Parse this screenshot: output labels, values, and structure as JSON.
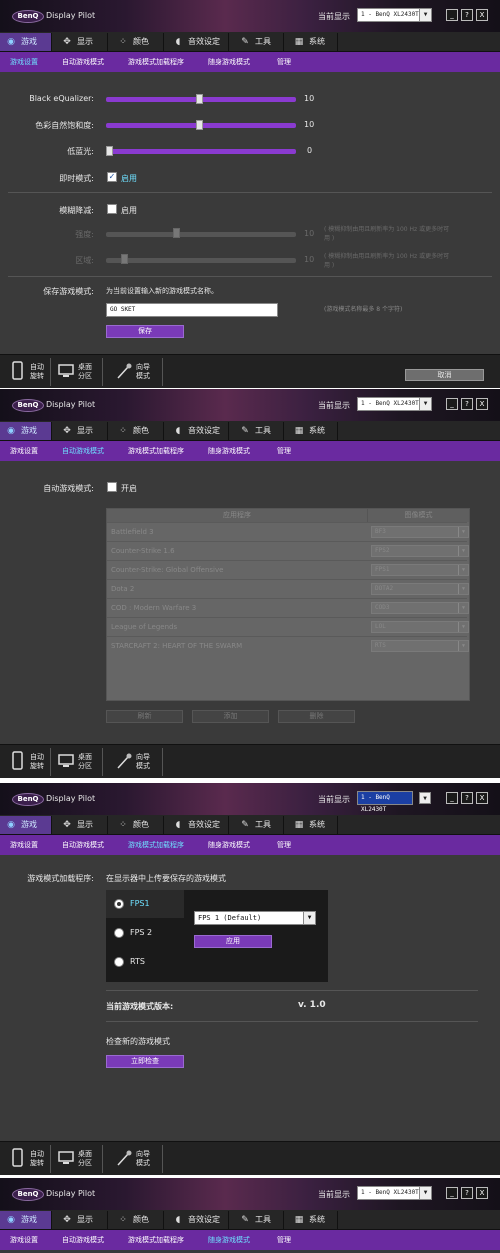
{
  "app": {
    "logo": "BenQ",
    "title": "Display Pilot",
    "monitor_label": "当前显示",
    "monitor_value": "1 - BenQ XL2430T",
    "minimize": "_",
    "help": "?",
    "close": "X"
  },
  "tabs": [
    {
      "label": "游戏",
      "icon": "gamepad-icon"
    },
    {
      "label": "显示",
      "icon": "display-move-icon"
    },
    {
      "label": "颜色",
      "icon": "palette-icon"
    },
    {
      "label": "音效设定",
      "icon": "speaker-icon"
    },
    {
      "label": "工具",
      "icon": "wrench-icon"
    },
    {
      "label": "系统",
      "icon": "system-icon"
    }
  ],
  "subtabs": [
    "游戏设置",
    "自动游戏模式",
    "游戏模式加载程序",
    "随身游戏模式",
    "管理"
  ],
  "footer": {
    "auto_rotate": "自动\n旋转",
    "desktop_partition": "桌面\n分区",
    "wizard": "向导\n模式",
    "cancel": "取消"
  },
  "panel1": {
    "black_eq_label": "Black eQualizer:",
    "black_eq_value": "10",
    "black_eq_level": 10,
    "saturation_label": "色彩自然饱和度:",
    "saturation_value": "10",
    "saturation_level": 10,
    "low_blue_label": "低蓝光:",
    "low_blue_value": "0",
    "low_blue_level": 0,
    "instant_label": "即时模式:",
    "instant_check": "✓",
    "instant_state": "启用",
    "blur_label": "模糊降减:",
    "blur_state": "启用",
    "intensity_label": "强度:",
    "intensity_value": "10",
    "area_label": "区域:",
    "area_value": "10",
    "blur_note": "( 模糊抑制由用且刷新率为 100 Hz 或更多时可\n用 )",
    "save_label": "保存游戏模式:",
    "save_hint": "为当前设置输入新的游戏模式名称。",
    "save_input": "GO SKET",
    "save_note": "(游戏模式名称最多 8 个字符)",
    "save_button": "保存"
  },
  "panel2": {
    "auto_label": "自动游戏模式:",
    "auto_state": "开启",
    "col_app": "应用程序",
    "col_mode": "图像模式",
    "rows": [
      {
        "app": "Battlefield 3",
        "mode": "BF3"
      },
      {
        "app": "Counter-Strike 1.6",
        "mode": "FPS2"
      },
      {
        "app": "Counter-Strike: Global Offensive",
        "mode": "FPS1"
      },
      {
        "app": "Dota 2",
        "mode": "DOTA2"
      },
      {
        "app": "COD : Modern Warfare 3",
        "mode": "COD3"
      },
      {
        "app": "League of Legends",
        "mode": "LOL"
      },
      {
        "app": "STARCRAFT 2: HEART OF THE SWARM",
        "mode": "RTS"
      }
    ],
    "btn_refresh": "刷新",
    "btn_add": "添加",
    "btn_delete": "删除"
  },
  "panel3": {
    "loader_label": "游戏模式加载程序:",
    "loader_hint": "在显示器中上传要保存的游戏模式",
    "modes": [
      "FPS1",
      "FPS 2",
      "RTS"
    ],
    "select_value": "FPS 1 (Default)",
    "apply_button": "应用",
    "version_label": "当前游戏模式版本:",
    "version_value": "v. 1.0",
    "check_label": "检查新的游戏模式",
    "check_button": "立即检查"
  },
  "colors": {
    "accent": "#6a2aa0",
    "slider": "#8a3ad0",
    "active_text": "#6fe0ff"
  }
}
